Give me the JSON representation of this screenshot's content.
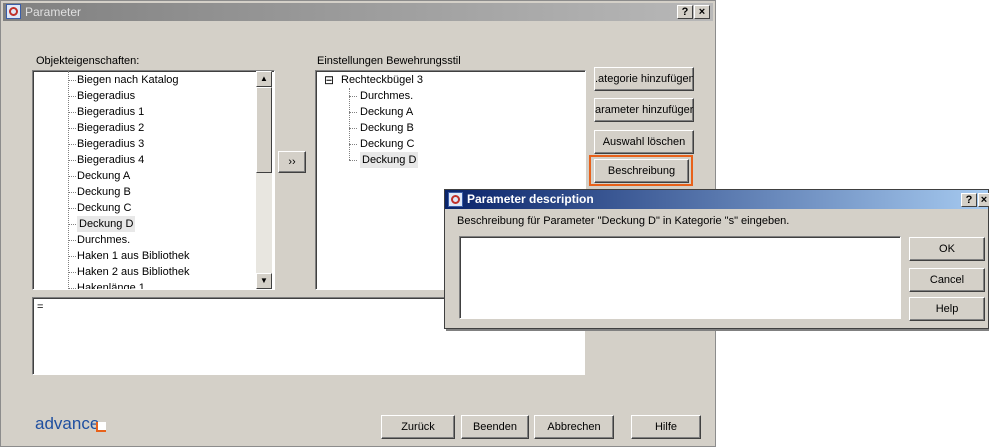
{
  "main_window": {
    "title": "Parameter",
    "help_btn": "?",
    "close_btn": "×",
    "properties_label": "Objekteigenschaften:",
    "properties_items": [
      "Biegen nach Katalog",
      "Biegeradius",
      "Biegeradius 1",
      "Biegeradius 2",
      "Biegeradius 3",
      "Biegeradius 4",
      "Deckung A",
      "Deckung B",
      "Deckung C",
      "Deckung D",
      "Durchmes.",
      "Haken 1 aus Bibliothek",
      "Haken 2 aus Bibliothek",
      "Hakenlänge 1"
    ],
    "properties_selected": "Deckung D",
    "add_arrow_btn": "››",
    "settings_label": "Einstellungen Bewehrungsstil",
    "settings_root": "Rechteckbügel 3",
    "settings_expand": "⊟",
    "settings_items": [
      "Durchmes.",
      "Deckung A",
      "Deckung B",
      "Deckung C",
      "Deckung D"
    ],
    "side_buttons": {
      "add_category": ".ategorie hinzufügen",
      "add_parameter": "arameter hinzufüger",
      "delete_selection": "Auswahl löschen",
      "description": "Beschreibung"
    },
    "expression_text": "=",
    "logo_text": "advance",
    "bottom_buttons": {
      "back": "Zurück",
      "finish": "Beenden",
      "cancel": "Abbrechen",
      "help": "Hilfe"
    }
  },
  "description_dialog": {
    "title": "Parameter description",
    "help_btn": "?",
    "close_btn": "×",
    "prompt": "Beschreibung für Parameter \"Deckung D\" in Kategorie \"s\" eingeben.",
    "text_value": "",
    "ok": "OK",
    "cancel": "Cancel",
    "help": "Help"
  },
  "colors": {
    "highlight": "#e8611a",
    "active_title": "#0a246a",
    "inactive_title": "#808080"
  }
}
